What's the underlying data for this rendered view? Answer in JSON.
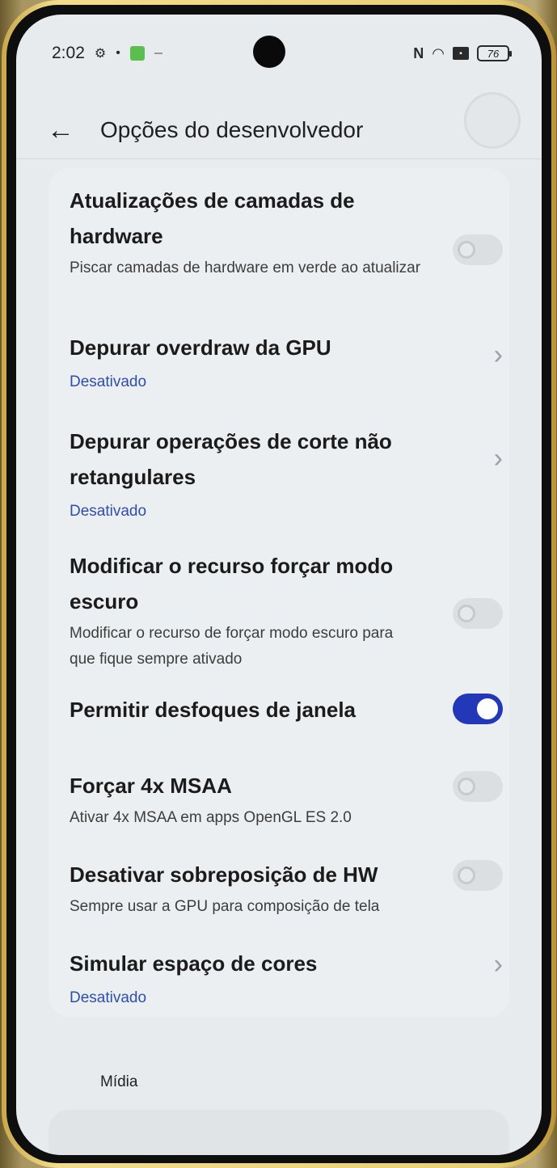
{
  "status_bar": {
    "time": "2:02",
    "battery": "76",
    "icons": [
      "gear-status-icon",
      "small-status-icon",
      "green-app-icon",
      "dash-icon",
      "nfc-icon",
      "wifi-icon",
      "sim-icon",
      "battery-icon"
    ]
  },
  "header": {
    "back_icon": "arrow-left-icon",
    "title": "Opções do desenvolvedor"
  },
  "settings": {
    "items": [
      {
        "title": "Atualizações de camadas de hardware",
        "subtitle": "Piscar camadas de hardware em verde ao atualizar",
        "control": "toggle",
        "checked": false
      },
      {
        "title": "Depurar overdraw da GPU",
        "status": "Desativado",
        "control": "chevron"
      },
      {
        "title": "Depurar operações de corte não retangulares",
        "status": "Desativado",
        "control": "chevron"
      },
      {
        "title": "Modificar o recurso forçar modo escuro",
        "subtitle": "Modificar o recurso de forçar modo escuro para que fique sempre ativado",
        "control": "toggle",
        "checked": false
      },
      {
        "title": "Permitir desfoques de janela",
        "control": "toggle",
        "checked": true
      },
      {
        "title": "Forçar 4x MSAA",
        "subtitle": "Ativar 4x MSAA em apps OpenGL ES 2.0",
        "control": "toggle",
        "checked": false
      },
      {
        "title": "Desativar sobreposição de HW",
        "subtitle": "Sempre usar a GPU para composição de tela",
        "control": "toggle",
        "checked": false
      },
      {
        "title": "Simular espaço de cores",
        "status": "Desativado",
        "control": "chevron"
      }
    ]
  },
  "section": {
    "label": "Mídia"
  },
  "colors": {
    "accent": "#2238b8",
    "status_text": "#2f4ea8",
    "screen_bg": "#e7ebee",
    "card_bg": "#eceff1"
  }
}
